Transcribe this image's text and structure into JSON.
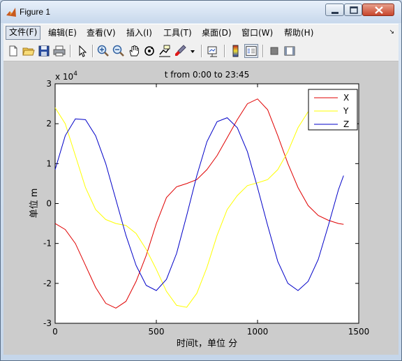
{
  "window": {
    "title": "Figure 1"
  },
  "menu": [
    {
      "label": "文件(F)"
    },
    {
      "label": "编辑(E)"
    },
    {
      "label": "查看(V)"
    },
    {
      "label": "插入(I)"
    },
    {
      "label": "工具(T)"
    },
    {
      "label": "桌面(D)"
    },
    {
      "label": "窗口(W)"
    },
    {
      "label": "帮助(H)"
    }
  ],
  "toolbar": {
    "icons": [
      "new-figure-icon",
      "open-file-icon",
      "save-icon",
      "print-icon",
      "pointer-icon",
      "zoom-in-icon",
      "zoom-out-icon",
      "pan-hand-icon",
      "rotate-3d-icon",
      "data-cursor-icon",
      "brush-icon",
      "brush-dropdown-icon",
      "link-plot-icon",
      "colorbar-icon",
      "legend-icon",
      "hide-plot-tools-icon",
      "show-plot-tools-icon"
    ]
  },
  "colors": {
    "x": "#e00000",
    "y": "#ffff00",
    "z": "#0000c8"
  },
  "chart_data": {
    "type": "line",
    "title": "t from 0:00 to 23:45",
    "xlabel": "时间t，单位 分",
    "ylabel": "单位 m",
    "y_exponent_label": "x 10",
    "y_exponent": "4",
    "xlim": [
      0,
      1500
    ],
    "ylim": [
      -3,
      3
    ],
    "y_scale_note": "values in units of 10^4 m",
    "x_ticks": [
      "0",
      "500",
      "1000",
      "1500"
    ],
    "y_ticks": [
      "3",
      "2",
      "1",
      "0",
      "-1",
      "-2",
      "-3"
    ],
    "legend_position": "top-right",
    "grid": false,
    "series": [
      {
        "name": "X",
        "color": "#e00000",
        "x": [
          0,
          50,
          100,
          150,
          200,
          250,
          300,
          350,
          400,
          450,
          500,
          550,
          600,
          650,
          700,
          750,
          800,
          850,
          900,
          950,
          1000,
          1050,
          1100,
          1150,
          1200,
          1250,
          1300,
          1350,
          1400,
          1425
        ],
        "y": [
          -0.5,
          -0.65,
          -1.0,
          -1.55,
          -2.1,
          -2.5,
          -2.62,
          -2.45,
          -1.95,
          -1.3,
          -0.5,
          0.15,
          0.42,
          0.5,
          0.6,
          0.85,
          1.2,
          1.65,
          2.1,
          2.5,
          2.62,
          2.35,
          1.7,
          1.0,
          0.4,
          -0.05,
          -0.3,
          -0.42,
          -0.5,
          -0.52
        ]
      },
      {
        "name": "Y",
        "color": "#ffff00",
        "x": [
          0,
          50,
          100,
          150,
          200,
          250,
          300,
          350,
          400,
          450,
          500,
          550,
          600,
          650,
          700,
          750,
          800,
          850,
          900,
          950,
          1000,
          1050,
          1100,
          1150,
          1200,
          1250
        ],
        "y": [
          2.4,
          2.0,
          1.2,
          0.4,
          -0.15,
          -0.4,
          -0.5,
          -0.55,
          -0.75,
          -1.15,
          -1.65,
          -2.2,
          -2.55,
          -2.6,
          -2.25,
          -1.6,
          -0.8,
          -0.15,
          0.2,
          0.45,
          0.52,
          0.6,
          0.85,
          1.3,
          1.9,
          2.3
        ]
      },
      {
        "name": "Z",
        "color": "#0000c8",
        "x": [
          0,
          50,
          100,
          150,
          200,
          250,
          300,
          350,
          400,
          450,
          500,
          550,
          600,
          650,
          700,
          750,
          800,
          850,
          900,
          950,
          1000,
          1050,
          1100,
          1150,
          1200,
          1250,
          1300,
          1350,
          1400,
          1425
        ],
        "y": [
          0.85,
          1.7,
          2.12,
          2.1,
          1.7,
          1.0,
          0.1,
          -0.8,
          -1.55,
          -2.05,
          -2.18,
          -1.9,
          -1.25,
          -0.3,
          0.7,
          1.55,
          2.05,
          2.15,
          1.9,
          1.3,
          0.4,
          -0.55,
          -1.45,
          -2.0,
          -2.18,
          -1.95,
          -1.4,
          -0.55,
          0.35,
          0.7
        ]
      }
    ]
  }
}
